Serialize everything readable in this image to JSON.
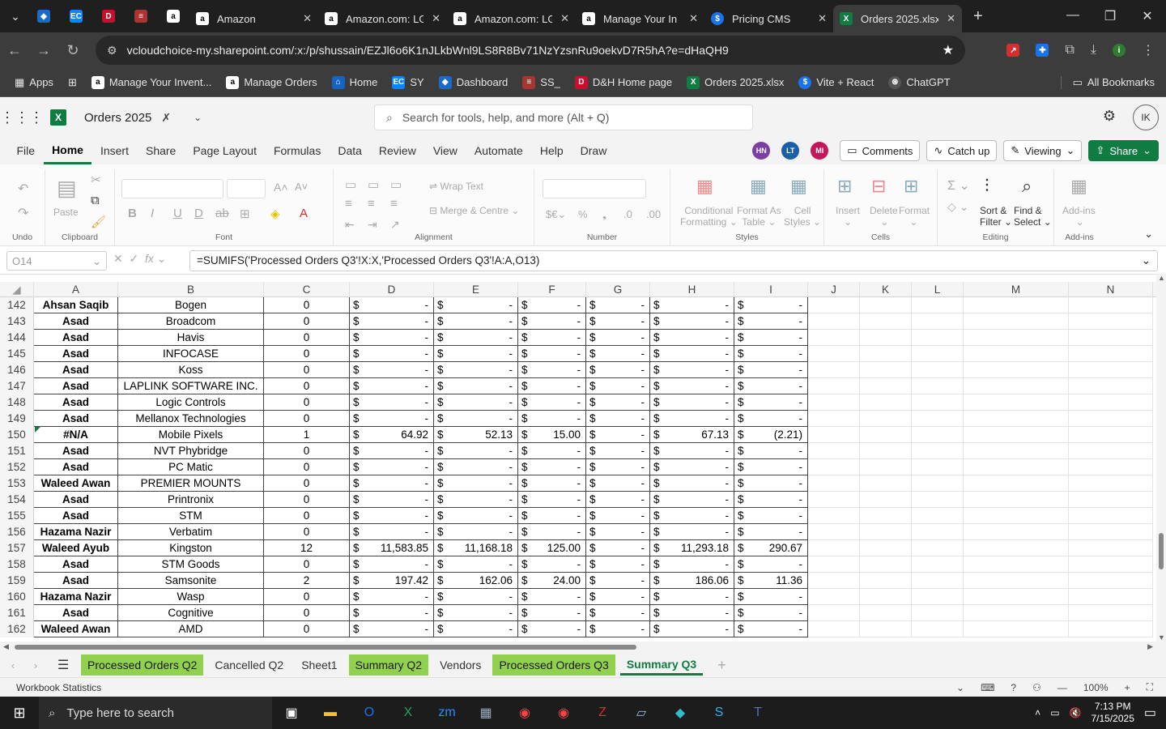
{
  "browser": {
    "tabs": [
      {
        "title": "Amazon",
        "icon": "amazon-icon"
      },
      {
        "title": "Amazon.com: LG",
        "icon": "amazon-icon"
      },
      {
        "title": "Amazon.com: LG",
        "icon": "amazon-icon"
      },
      {
        "title": "Manage Your In",
        "icon": "amazon-icon"
      },
      {
        "title": "Pricing CMS",
        "icon": "dollar-icon"
      },
      {
        "title": "Orders 2025.xlsx",
        "icon": "excel-icon",
        "active": true
      }
    ],
    "url": "vcloudchoice-my.sharepoint.com/:x:/p/shussain/EZJl6o6K1nJLkbWnl9LS8R8Bv71NzYzsnRu9oekvD7R5hA?e=dHaQH9",
    "bookmarks": [
      "Apps",
      "Manage Your Invent...",
      "Manage Orders",
      "Home",
      "SY",
      "Dashboard",
      "SS_",
      "D&H Home page",
      "Orders 2025.xlsx",
      "Vite + React",
      "ChatGPT"
    ],
    "all_bookmarks": "All Bookmarks"
  },
  "app": {
    "file_name": "Orders 2025",
    "search_placeholder": "Search for tools, help, and more (Alt + Q)",
    "user_initials": "IK",
    "menu": [
      "File",
      "Home",
      "Insert",
      "Share",
      "Page Layout",
      "Formulas",
      "Data",
      "Review",
      "View",
      "Automate",
      "Help",
      "Draw"
    ],
    "presence": [
      "HN",
      "LT",
      "MI"
    ],
    "comments": "Comments",
    "catch_up": "Catch up",
    "viewing": "Viewing",
    "share": "Share"
  },
  "ribbon": {
    "undo_group": "Undo",
    "paste": "Paste",
    "clipboard": "Clipboard",
    "font": "Font",
    "wrap_text": "Wrap Text",
    "merge_centre": "Merge & Centre",
    "alignment": "Alignment",
    "number": "Number",
    "cond_fmt_1": "Conditional",
    "cond_fmt_2": "Formatting",
    "fmt_table_1": "Format As",
    "fmt_table_2": "Table",
    "cell_styles_1": "Cell",
    "cell_styles_2": "Styles",
    "styles": "Styles",
    "insert": "Insert",
    "delete": "Delete",
    "format": "Format",
    "cells": "Cells",
    "sort_1": "Sort &",
    "sort_2": "Filter",
    "find_1": "Find &",
    "find_2": "Select",
    "editing": "Editing",
    "addins_1": "Add-ins",
    "addins": "Add-ins"
  },
  "formula_bar": {
    "name_box": "O14",
    "formula": "=SUMIFS('Processed Orders Q3'!X:X,'Processed Orders Q3'!A:A,O13)"
  },
  "columns": [
    "A",
    "B",
    "C",
    "D",
    "E",
    "F",
    "G",
    "H",
    "I",
    "J",
    "K",
    "L",
    "M",
    "N"
  ],
  "rows": [
    {
      "n": "142",
      "a": "Ahsan Saqib",
      "b": "Bogen",
      "c": "0",
      "d": "-",
      "e": "-",
      "f": "-",
      "g": "-",
      "h": "-",
      "i": "-"
    },
    {
      "n": "143",
      "a": "Asad",
      "b": "Broadcom",
      "c": "0",
      "d": "-",
      "e": "-",
      "f": "-",
      "g": "-",
      "h": "-",
      "i": "-"
    },
    {
      "n": "144",
      "a": "Asad",
      "b": "Havis",
      "c": "0",
      "d": "-",
      "e": "-",
      "f": "-",
      "g": "-",
      "h": "-",
      "i": "-"
    },
    {
      "n": "145",
      "a": "Asad",
      "b": "INFOCASE",
      "c": "0",
      "d": "-",
      "e": "-",
      "f": "-",
      "g": "-",
      "h": "-",
      "i": "-"
    },
    {
      "n": "146",
      "a": "Asad",
      "b": "Koss",
      "c": "0",
      "d": "-",
      "e": "-",
      "f": "-",
      "g": "-",
      "h": "-",
      "i": "-"
    },
    {
      "n": "147",
      "a": "Asad",
      "b": "LAPLINK SOFTWARE INC.",
      "c": "0",
      "d": "-",
      "e": "-",
      "f": "-",
      "g": "-",
      "h": "-",
      "i": "-"
    },
    {
      "n": "148",
      "a": "Asad",
      "b": "Logic Controls",
      "c": "0",
      "d": "-",
      "e": "-",
      "f": "-",
      "g": "-",
      "h": "-",
      "i": "-"
    },
    {
      "n": "149",
      "a": "Asad",
      "b": "Mellanox Technologies",
      "c": "0",
      "d": "-",
      "e": "-",
      "f": "-",
      "g": "-",
      "h": "-",
      "i": "-"
    },
    {
      "n": "150",
      "a": "#N/A",
      "b": "Mobile Pixels",
      "c": "1",
      "d": "64.92",
      "e": "52.13",
      "f": "15.00",
      "g": "-",
      "h": "67.13",
      "i": "(2.21)"
    },
    {
      "n": "151",
      "a": "Asad",
      "b": "NVT Phybridge",
      "c": "0",
      "d": "-",
      "e": "-",
      "f": "-",
      "g": "-",
      "h": "-",
      "i": "-"
    },
    {
      "n": "152",
      "a": "Asad",
      "b": "PC Matic",
      "c": "0",
      "d": "-",
      "e": "-",
      "f": "-",
      "g": "-",
      "h": "-",
      "i": "-"
    },
    {
      "n": "153",
      "a": "Waleed Awan",
      "b": "PREMIER MOUNTS",
      "c": "0",
      "d": "-",
      "e": "-",
      "f": "-",
      "g": "-",
      "h": "-",
      "i": "-"
    },
    {
      "n": "154",
      "a": "Asad",
      "b": "Printronix",
      "c": "0",
      "d": "-",
      "e": "-",
      "f": "-",
      "g": "-",
      "h": "-",
      "i": "-"
    },
    {
      "n": "155",
      "a": "Asad",
      "b": "STM",
      "c": "0",
      "d": "-",
      "e": "-",
      "f": "-",
      "g": "-",
      "h": "-",
      "i": "-"
    },
    {
      "n": "156",
      "a": "Hazama Nazir",
      "b": "Verbatim",
      "c": "0",
      "d": "-",
      "e": "-",
      "f": "-",
      "g": "-",
      "h": "-",
      "i": "-"
    },
    {
      "n": "157",
      "a": "Waleed Ayub",
      "b": "Kingston",
      "c": "12",
      "d": "11,583.85",
      "e": "11,168.18",
      "f": "125.00",
      "g": "-",
      "h": "11,293.18",
      "i": "290.67"
    },
    {
      "n": "158",
      "a": "Asad",
      "b": "STM Goods",
      "c": "0",
      "d": "-",
      "e": "-",
      "f": "-",
      "g": "-",
      "h": "-",
      "i": "-"
    },
    {
      "n": "159",
      "a": "Asad",
      "b": "Samsonite",
      "c": "2",
      "d": "197.42",
      "e": "162.06",
      "f": "24.00",
      "g": "-",
      "h": "186.06",
      "i": "11.36"
    },
    {
      "n": "160",
      "a": "Hazama Nazir",
      "b": "Wasp",
      "c": "0",
      "d": "-",
      "e": "-",
      "f": "-",
      "g": "-",
      "h": "-",
      "i": "-"
    },
    {
      "n": "161",
      "a": "Asad",
      "b": "Cognitive",
      "c": "0",
      "d": "-",
      "e": "-",
      "f": "-",
      "g": "-",
      "h": "-",
      "i": "-"
    },
    {
      "n": "162",
      "a": "Waleed Awan",
      "b": "AMD",
      "c": "0",
      "d": "-",
      "e": "-",
      "f": "-",
      "g": "-",
      "h": "-",
      "i": "-"
    }
  ],
  "currency_symbol": "$",
  "sheets": [
    {
      "name": "Processed Orders Q2",
      "green": true
    },
    {
      "name": "Cancelled Q2"
    },
    {
      "name": "Sheet1"
    },
    {
      "name": "Summary Q2",
      "green": true
    },
    {
      "name": "Vendors"
    },
    {
      "name": "Processed Orders Q3",
      "green": true
    },
    {
      "name": "Summary Q3",
      "active": true
    }
  ],
  "status": {
    "left": "Workbook Statistics",
    "zoom": "100%"
  },
  "taskbar": {
    "search_placeholder": "Type here to search",
    "time": "7:13 PM",
    "date": "7/15/2025"
  },
  "colors": {
    "excel_green": "#107c41",
    "sheet_green": "#92d050"
  }
}
